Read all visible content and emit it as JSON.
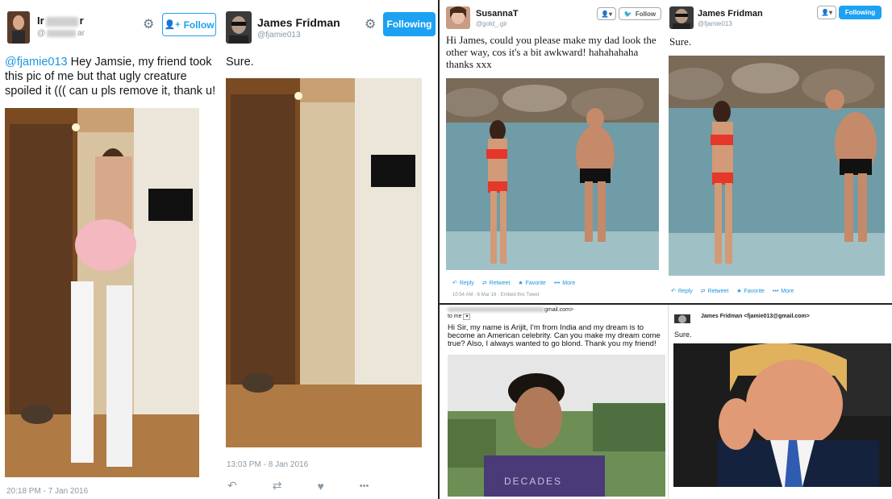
{
  "panel1": {
    "user_name": "Ir",
    "user_name_tail": "r",
    "user_handle": "@",
    "user_handle_tail": "ar",
    "follow_label": "Follow",
    "mention": "@fjamie013",
    "tweet_text": " Hey Jamsie, my friend took this pic of me but that ugly creature spoiled it ((( can u pls remove it, thank u!",
    "timestamp": "20:18 PM - 7 Jan 2016"
  },
  "panel2": {
    "user_name": "James Fridman",
    "user_handle": "@fjamie013",
    "following_label": "Following",
    "tweet_text": "Sure.",
    "timestamp": "13:03 PM - 8 Jan 2016",
    "more_label": "•••"
  },
  "panel3": {
    "user_name": "SusannaT",
    "user_handle": "@gold_.gir",
    "follow_label": "Follow",
    "tweet_text": "Hi James, could you please make my dad look the other way, cos it's a bit awkward! hahahahaha thanks xxx",
    "reply_label": "Reply",
    "retweet_label": "Retweet",
    "favorite_label": "Favorite",
    "more_label": "More",
    "timestamp": "10:54 AM - 6 Mar 16 · Embed this Tweet"
  },
  "panel4": {
    "user_name": "James Fridman",
    "user_handle": "@fjamie013",
    "following_label": "Following",
    "tweet_text": "Sure.",
    "reply_label": "Reply",
    "retweet_label": "Retweet",
    "favorite_label": "Favorite",
    "more_label": "More"
  },
  "panel5": {
    "from_tail": "gmail.com>",
    "to_label": "to me",
    "email_text": "Hi Sir, my name is Arijit, I'm from India and my dream is to become an American celebrity. Can you make my dream come true? Also, I always wanted to go blond. Thank you my friend!",
    "shirt_text": "DECADES"
  },
  "panel6": {
    "from_line": "James Fridman <fjamie013@gmail.com>",
    "email_text": "Sure."
  },
  "colors": {
    "twitter_blue": "#1da1f2",
    "link_blue": "#1b95e0",
    "meta_grey": "#8899a6"
  }
}
